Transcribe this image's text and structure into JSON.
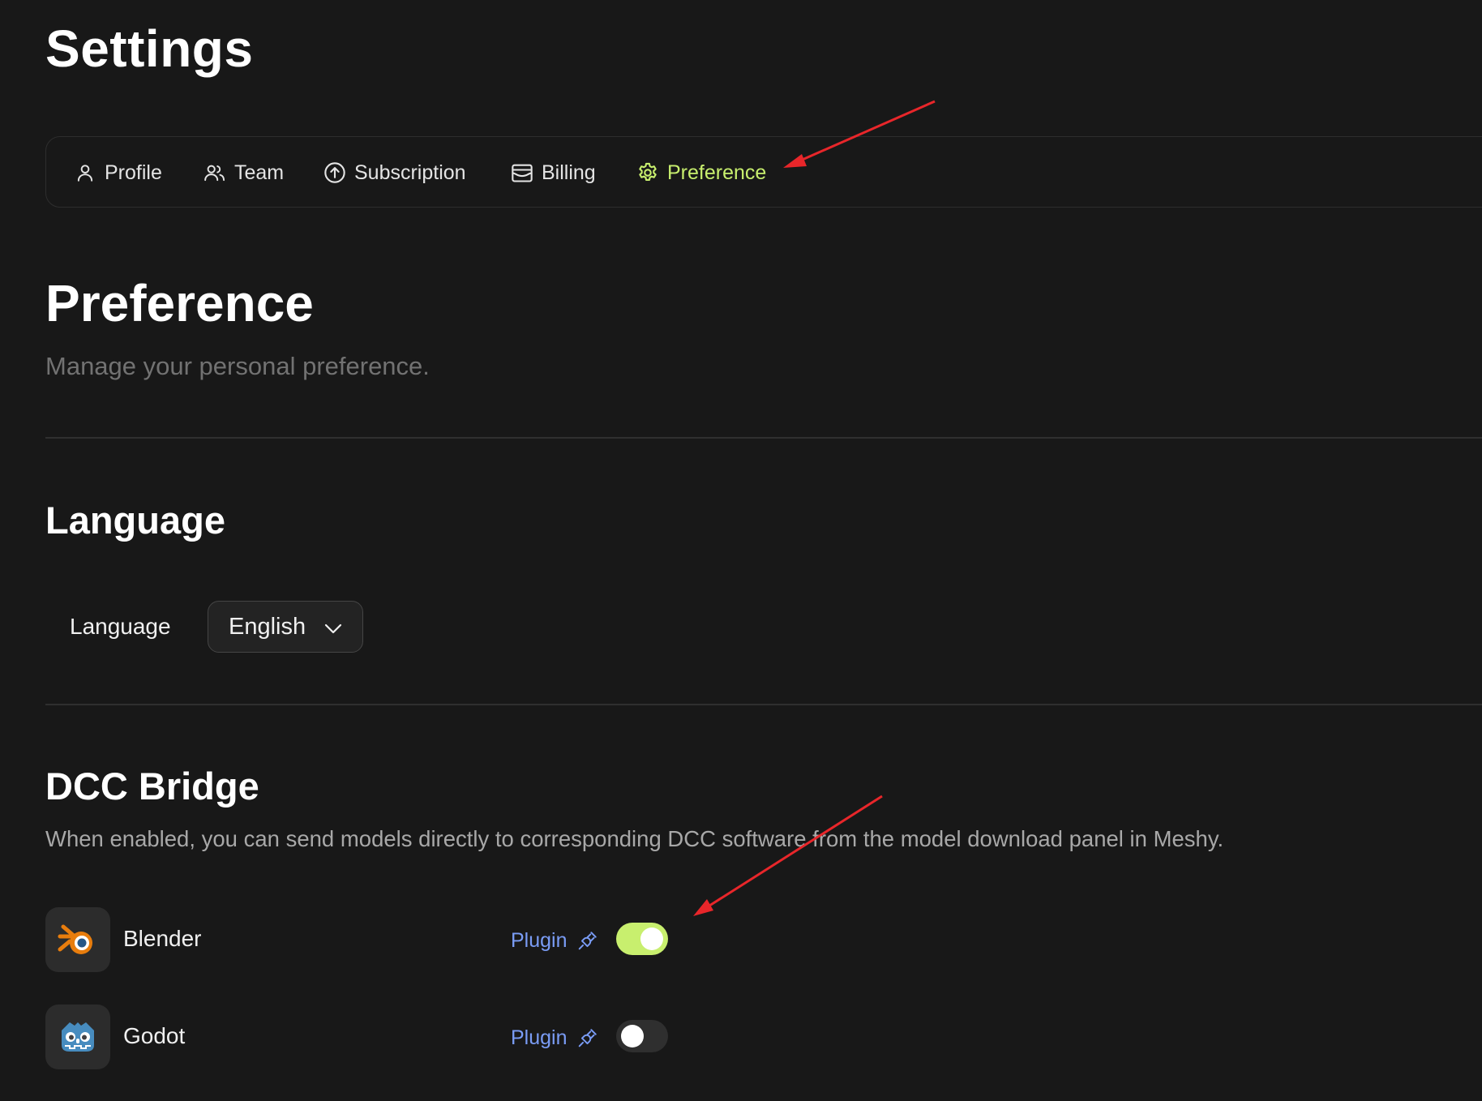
{
  "page": {
    "title": "Settings"
  },
  "tabs": [
    {
      "label": "Profile",
      "icon": "user-icon",
      "active": false
    },
    {
      "label": "Team",
      "icon": "users-icon",
      "active": false
    },
    {
      "label": "Subscription",
      "icon": "upgrade-circle-icon",
      "active": false
    },
    {
      "label": "Billing",
      "icon": "wallet-icon",
      "active": false
    },
    {
      "label": "Preference",
      "icon": "gear-icon",
      "active": true
    }
  ],
  "preference": {
    "heading": "Preference",
    "subtitle": "Manage your personal preference."
  },
  "language": {
    "heading": "Language",
    "label": "Language",
    "selected": "English"
  },
  "dcc": {
    "heading": "DCC Bridge",
    "description": "When enabled, you can send models directly to corresponding DCC software from the model download panel in Meshy.",
    "apps": [
      {
        "name": "Blender",
        "plugin_label": "Plugin",
        "enabled": true,
        "icon": "blender-logo-icon"
      },
      {
        "name": "Godot",
        "plugin_label": "Plugin",
        "enabled": false,
        "icon": "godot-logo-icon"
      }
    ]
  },
  "colors": {
    "background": "#181818",
    "accent": "#c8ef6e",
    "link": "#7a9cf5",
    "annotation_arrow": "#e8262a"
  }
}
